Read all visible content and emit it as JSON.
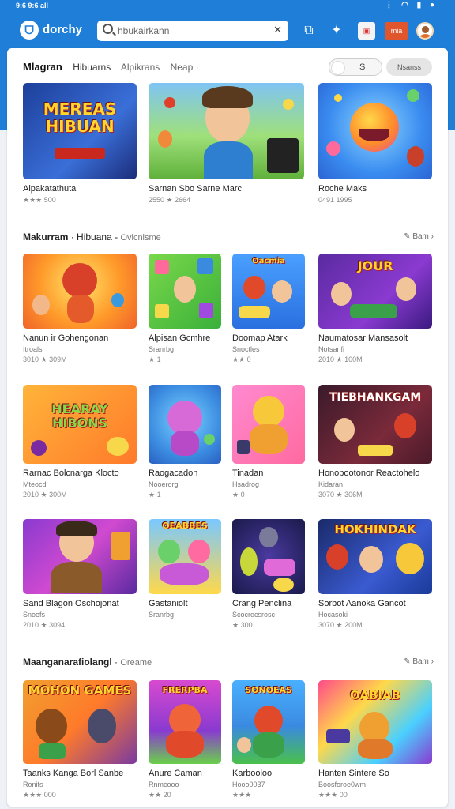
{
  "status": {
    "time": "9:6 9:6 all",
    "icons": "⋮ ◠ ▮ ●"
  },
  "header": {
    "brand": "dorchy",
    "search_value": "hbukairkann",
    "badge1": "",
    "badge2": "mia"
  },
  "tabs": {
    "active": "Mlagran",
    "t2": "Hibuarns",
    "t3": "Alpikrans",
    "t4": "Neap ·"
  },
  "toggle_text": "S",
  "pill_text": "Nsanss",
  "sections": {
    "s2": {
      "title": "Makurram",
      "sub1": "Hibuana",
      "sub2": "Ovicnisme",
      "more": "Bam ›"
    },
    "s3": {
      "title": "Maanganarafiolangl",
      "sub": "Oreame",
      "more": "Bam ›"
    }
  },
  "featured": [
    {
      "thumb_text": "MEREAS HIBUAN",
      "title": "Alpakatathuta",
      "rating": "★★★ 500"
    },
    {
      "thumb_text": "",
      "title": "Sarnan Sbo Sarne Marc",
      "rating": "2550 ★ 2664"
    },
    {
      "thumb_text": "",
      "title": "Roche Maks",
      "rating": "0491 1995"
    }
  ],
  "grid": [
    {
      "thumb_text": "",
      "title": "Nanun ir Gohengonan",
      "sub": "Itroalsi",
      "rating": "3010 ★ 309M"
    },
    {
      "thumb_text": "",
      "title": "Alpisan Gcmhre",
      "sub": "Sranrbg",
      "rating": "★ 1"
    },
    {
      "thumb_text": "Oacmia",
      "title": "Doomap Atark",
      "sub": "Snoctles",
      "rating": "★★ 0"
    },
    {
      "thumb_text": "JOUR",
      "title": "Naumatosar Mansasolt",
      "sub": "Notsanfi",
      "rating": "2010 ★ 100M"
    },
    {
      "thumb_text": "HEARAY HIBONS",
      "title": "Rarnac Bolcnarga Klocto",
      "sub": "Mteocd",
      "rating": "2010 ★ 300M"
    },
    {
      "thumb_text": "",
      "title": "Raogacadon",
      "sub": "Nooerorg",
      "rating": "★ 1"
    },
    {
      "thumb_text": "",
      "title": "Tinadan",
      "sub": "Hsadrog",
      "rating": "★ 0"
    },
    {
      "thumb_text": "TIEBHANKGAM",
      "title": "Honopootonor Reactohelo",
      "sub": "Kidaran",
      "rating": "3070 ★ 306M"
    },
    {
      "thumb_text": "",
      "title": "Sand Blagon Oschojonat",
      "sub": "Snoefs",
      "rating": "2010 ★ 3094"
    },
    {
      "thumb_text": "OEABBES",
      "title": "Gastaniolt",
      "sub": "Sranrbg",
      "rating": ""
    },
    {
      "thumb_text": "",
      "title": "Crang Penclina",
      "sub": "Scocrocsrosc",
      "rating": "★ 300"
    },
    {
      "thumb_text": "HOKHINDAK",
      "title": "Sorbot Aanoka Gancot",
      "sub": "Hocasoki",
      "rating": "3070 ★ 200M"
    }
  ],
  "bottom": [
    {
      "thumb_text": "MOHON GAMES",
      "title": "Taanks Kanga Borl Sanbe",
      "sub": "Ronifs",
      "rating": "★★★ 000"
    },
    {
      "thumb_text": "FRERPBA",
      "title": "Anure Caman",
      "sub": "Rnmcooo",
      "rating": "★★ 20"
    },
    {
      "thumb_text": "SONOEAS",
      "title": "Karbooloo",
      "sub": "Hooo0037",
      "rating": "★★★"
    },
    {
      "thumb_text": "OABIAB",
      "title": "Hanten Sintere So",
      "sub": "Boosforoe0wm",
      "rating": "★★★ 00"
    }
  ]
}
